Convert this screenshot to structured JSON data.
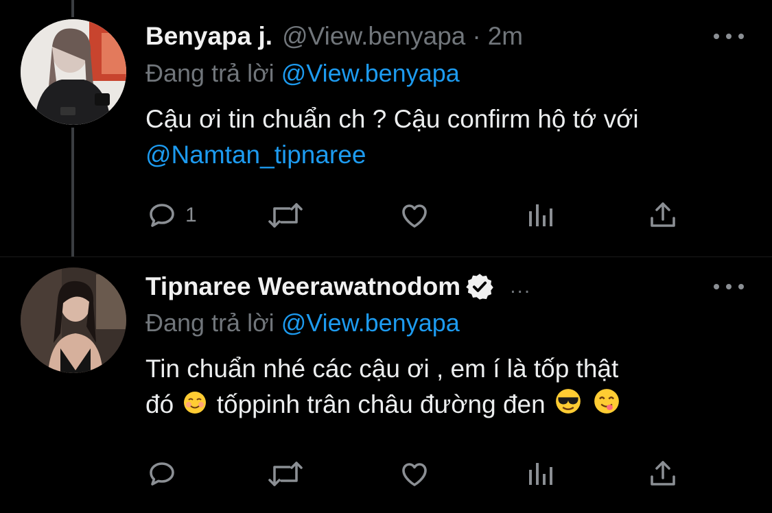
{
  "tweets": [
    {
      "name": "Benyapa j.",
      "handle": "@View.benyapa",
      "separator": "·",
      "time": "2m",
      "replying_prefix": "Đang trả lời",
      "replying_to": "@View.benyapa",
      "text": "Cậu ơi tin chuẩn ch ? Cậu confirm hộ tớ với",
      "mention": "@Namtan_tipnaree",
      "reply_count": "1"
    },
    {
      "name": "Tipnaree Weerawatnodom",
      "truncation": "...",
      "replying_prefix": "Đang trả lời",
      "replying_to": "@View.benyapa",
      "text_line1": "Tin chuẩn nhé các cậu ơi , em í là tốp thật",
      "text_line2_a": "đó",
      "text_line2_b": "tốppinh trân châu đường đen",
      "reply_count": ""
    }
  ],
  "icons": [
    "reply-icon",
    "retweet-icon",
    "like-icon",
    "analytics-icon",
    "share-icon",
    "more-icon",
    "verified-badge-icon",
    "smiling-emoji-icon",
    "sunglasses-emoji-icon",
    "yum-emoji-icon"
  ],
  "colors": {
    "background": "#000000",
    "link": "#1d9bf0",
    "secondary": "#71767b",
    "text": "#e7e9ea"
  }
}
